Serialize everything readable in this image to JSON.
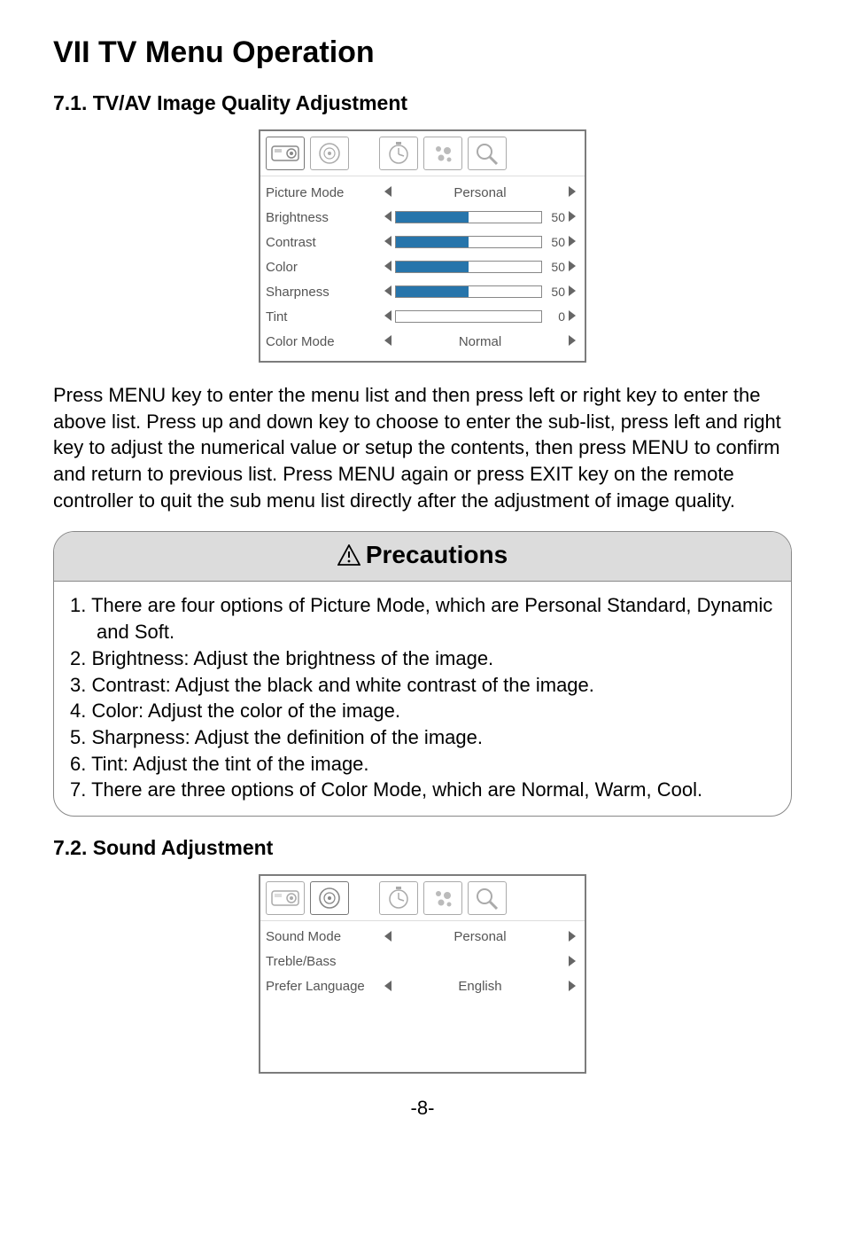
{
  "title": "VII  TV Menu Operation",
  "section1_title": "7.1. TV/AV Image Quality Adjustment",
  "menu1": {
    "items": [
      {
        "label": "Picture Mode",
        "kind": "text",
        "value": "Personal"
      },
      {
        "label": "Brightness",
        "kind": "bar",
        "value": "50",
        "fill": 50
      },
      {
        "label": "Contrast",
        "kind": "bar",
        "value": "50",
        "fill": 50
      },
      {
        "label": "Color",
        "kind": "bar",
        "value": "50",
        "fill": 50
      },
      {
        "label": "Sharpness",
        "kind": "bar",
        "value": "50",
        "fill": 50
      },
      {
        "label": "Tint",
        "kind": "bar",
        "value": "0",
        "fill": 0
      },
      {
        "label": "Color Mode",
        "kind": "text",
        "value": "Normal"
      }
    ]
  },
  "paragraph": "Press MENU key to enter the menu list and then press left or right key to enter the above list. Press up and down key to choose to enter the sub-list, press left and right key to adjust the numerical value or setup the contents, then press MENU to confirm and return to previous list. Press MENU again or press EXIT key on the remote controller to quit the sub menu list directly after the adjustment of image quality.",
  "precaution_title": "Precautions",
  "precautions": [
    "1. There are four options of Picture Mode, which are Personal Standard, Dynamic and Soft.",
    "2. Brightness: Adjust the brightness of the image.",
    "3. Contrast: Adjust the black and white contrast of the image.",
    "4. Color: Adjust the color of the image.",
    "5. Sharpness: Adjust the definition of the image.",
    "6. Tint: Adjust the tint of the image.",
    "7. There are three options of Color Mode, which are Normal, Warm, Cool."
  ],
  "section2_title": "7.2. Sound Adjustment",
  "menu2": {
    "items": [
      {
        "label": "Sound Mode",
        "kind": "text",
        "value": "Personal"
      },
      {
        "label": "Treble/Bass",
        "kind": "arrow",
        "value": ""
      },
      {
        "label": "Prefer Language",
        "kind": "text",
        "value": "English"
      }
    ]
  },
  "page_number": "-8-",
  "icons": [
    "picture-icon",
    "sound-icon",
    "timer-icon",
    "option-icon",
    "search-icon"
  ]
}
